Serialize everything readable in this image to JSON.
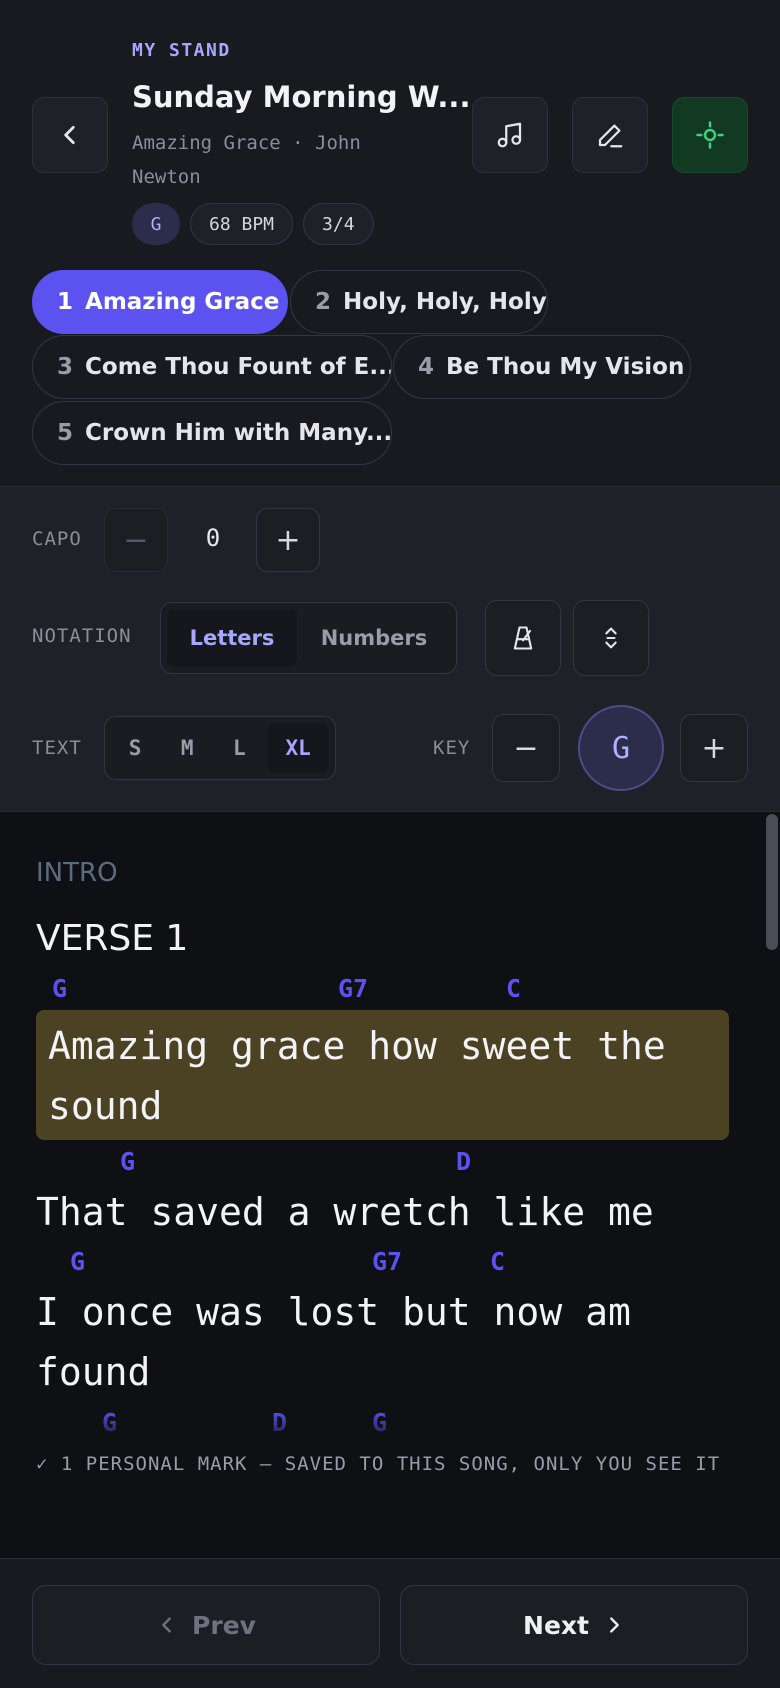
{
  "header": {
    "eyebrow": "MY STAND",
    "title": "Sunday Morning W...",
    "subtitle": "Amazing Grace · John Newton",
    "key_pill": "G",
    "bpm_pill": "68 BPM",
    "time_pill": "3/4"
  },
  "setlist": [
    {
      "num": "1",
      "title": "Amazing Grace",
      "active": true
    },
    {
      "num": "2",
      "title": "Holy, Holy, Holy",
      "active": false
    },
    {
      "num": "3",
      "title": "Come Thou Fount of E...",
      "active": false
    },
    {
      "num": "4",
      "title": "Be Thou My Vision",
      "active": false
    },
    {
      "num": "5",
      "title": "Crown Him with Many...",
      "active": false
    }
  ],
  "controls": {
    "capo_label": "CAPO",
    "capo_value": "0",
    "notation_label": "NOTATION",
    "notation_options": [
      "Letters",
      "Numbers"
    ],
    "notation_selected": "Letters",
    "text_label": "TEXT",
    "text_sizes": [
      "S",
      "M",
      "L",
      "XL"
    ],
    "text_selected": "XL",
    "key_label": "KEY",
    "key_value": "G"
  },
  "sheet": {
    "intro_label": "INTRO",
    "verse_label": "VERSE 1",
    "lines": [
      {
        "chords": [
          "G",
          "G7",
          "C"
        ],
        "lyric_1": "Amazing grace how sweet the",
        "lyric_2": "sound",
        "highlighted": true
      },
      {
        "chords": [
          "G",
          "D"
        ],
        "lyric_1": "That saved a wretch like me",
        "highlighted": false
      },
      {
        "chords": [
          "G",
          "G7",
          "C"
        ],
        "lyric_1": "I once was lost but now am",
        "lyric_2": "found",
        "highlighted": false
      },
      {
        "chords": [
          "G",
          "D",
          "G"
        ],
        "highlighted": false
      }
    ],
    "mark_note": "✓ 1 PERSONAL MARK — SAVED TO THIS SONG, ONLY YOU SEE IT"
  },
  "footer": {
    "prev_label": "Prev",
    "next_label": "Next"
  },
  "colors": {
    "accent": "#5b52f0",
    "accent_text": "#a8a6ff",
    "highlight": "#4a4222",
    "focus_green": "#123a22"
  },
  "icons": {
    "back": "chevron-left-icon",
    "music": "music-note-icon",
    "edit": "pencil-icon",
    "focus": "crosshair-icon",
    "metronome": "metronome-icon",
    "expand": "expand-vertical-icon",
    "prev": "chevron-left-icon",
    "next": "chevron-right-icon"
  }
}
